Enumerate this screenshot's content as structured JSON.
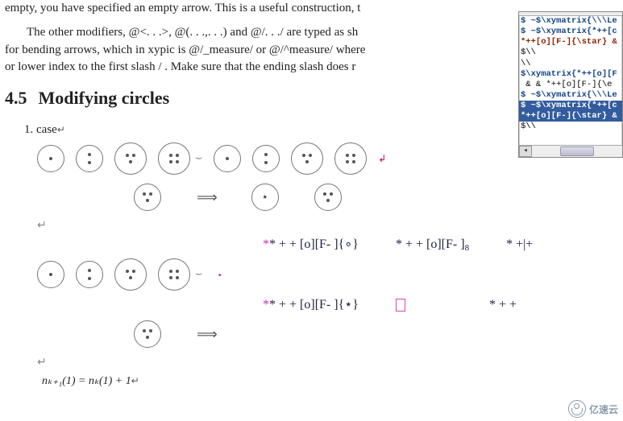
{
  "body": {
    "p1": "empty, you have specified an empty arrow. This is a useful construction, t",
    "p2a": "The other modifiers, @<. . .>, @(. . .,. . .) and @/. . ./ are typed as sh",
    "p2b": "for bending arrows, which in xypic is @/_measure/ or @/^measure/ where",
    "p2c": "or lower index to the first slash / . Make sure that the ending slash does r"
  },
  "section": {
    "num": "4.5",
    "title": "Modifying circles"
  },
  "list": {
    "n": "1.",
    "label": "case",
    "ret": "↵"
  },
  "symbols": {
    "uarr": "⌣",
    "dblarr": "⟹",
    "retL": "↵",
    "retR": "↲"
  },
  "formulas": {
    "a1": "* + + [o][F- ]{∘}",
    "a2_pre": "* + + [o][F- ]",
    "a2_suf": "8",
    "a3": "* +|+",
    "b1": "* + + [o][F- ]{⋆}",
    "b2": "* + +",
    "star_lead": "*"
  },
  "math": {
    "line1": "nₖ₊₁(1) = nₖ(1) + 1",
    "ret": "↵"
  },
  "sidebar": {
    "l1": "$ ~$\\xymatrix{\\\\\\Le",
    "l2": "$ ~$\\xymatrix{*++[c",
    "l3": "*++[o][F-]{\\star} &",
    "l4": "$\\\\",
    "l5": "\\\\",
    "l6": "$\\xymatrix{*++[o][F",
    "l7": " & & *++[o][F-]{\\e",
    "l8": "$ ~$\\xymatrix{\\\\\\Le",
    "l9": "$ ~$\\xymatrix{*++[c",
    "l10": "*++[o][F-]{\\star} &",
    "l11": "$\\\\",
    "scroll_left": "◂"
  },
  "logo": {
    "text": "亿速云"
  }
}
